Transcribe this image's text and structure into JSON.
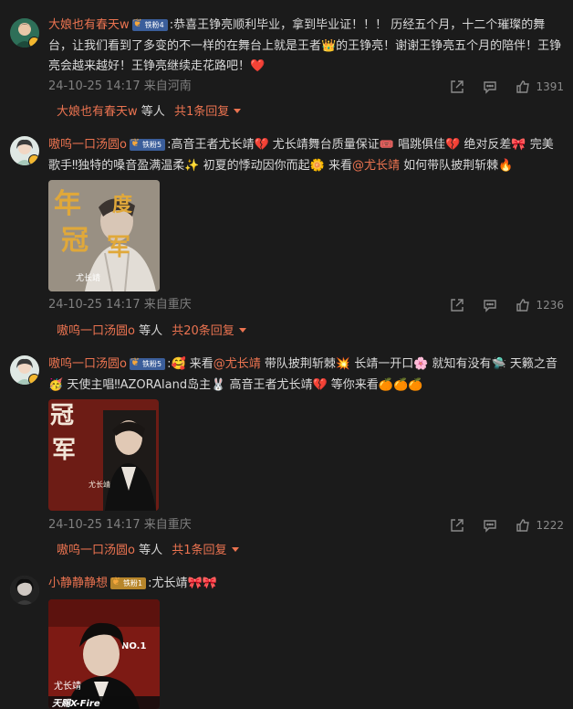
{
  "comments": [
    {
      "user": "大娘也有春天w",
      "badge": "铁粉4",
      "text": ":恭喜王铮亮顺利毕业，拿到毕业证！！！ 历经五个月，十二个璀璨的舞台，让我们看到了多变的不一样的在舞台上就是王者👑的王铮亮！谢谢王铮亮五个月的陪伴！王铮亮会越来越好！王铮亮继续走花路吧！❤️",
      "time": "24-10-25 14:17 来自河南",
      "likes": "1391",
      "reply_user": "大娘也有春天w",
      "reply_mid": "等人",
      "reply_count": "共1条回复"
    },
    {
      "user": "嗷呜一口汤圆o",
      "badge": "铁粉5",
      "text_a": ":高音王者尤长靖💔 尤长靖舞台质量保证🎟️ 唱跳俱佳💔 绝对反差🎀 完美歌手‼独特的嗓音盈满温柔✨ 初夏的悸动因你而起🌼 来看",
      "mention": "@尤长靖",
      "text_b": " 如何带队披荆斩棘🔥",
      "time": "24-10-25 14:17 来自重庆",
      "likes": "1236",
      "reply_user": "嗷呜一口汤圆o",
      "reply_mid": "等人",
      "reply_count": "共20条回复",
      "pic": {
        "title": "年度冠军",
        "name": "尤长靖"
      }
    },
    {
      "user": "嗷呜一口汤圆o",
      "badge": "铁粉5",
      "text_a": ":🥰 来看",
      "mention": "@尤长靖",
      "text_b": " 带队披荆斩棘💥 长靖一开口🌸 就知有没有🛸 天籁之音🥳 天使主唱‼AZORAland岛主🐰 高音王者尤长靖💔 等你来看🍊🍊🍊",
      "time": "24-10-25 14:17 来自重庆",
      "likes": "1222",
      "reply_user": "嗷呜一口汤圆o",
      "reply_mid": "等人",
      "reply_count": "共1条回复",
      "pic": {
        "title": "冠军",
        "name": "尤长靖"
      }
    },
    {
      "user": "小静静静想",
      "badge": "铁粉1",
      "text": ":尤长靖🎀🎀",
      "pic": {
        "label": "NO.1",
        "name": "尤长靖",
        "footer": "天赐X-Fire"
      }
    }
  ],
  "colors": {
    "accent": "#eb7350",
    "background": "#1b1b1b",
    "muted": "#808080"
  },
  "icons": [
    "share-icon",
    "comment-icon",
    "like-icon"
  ]
}
